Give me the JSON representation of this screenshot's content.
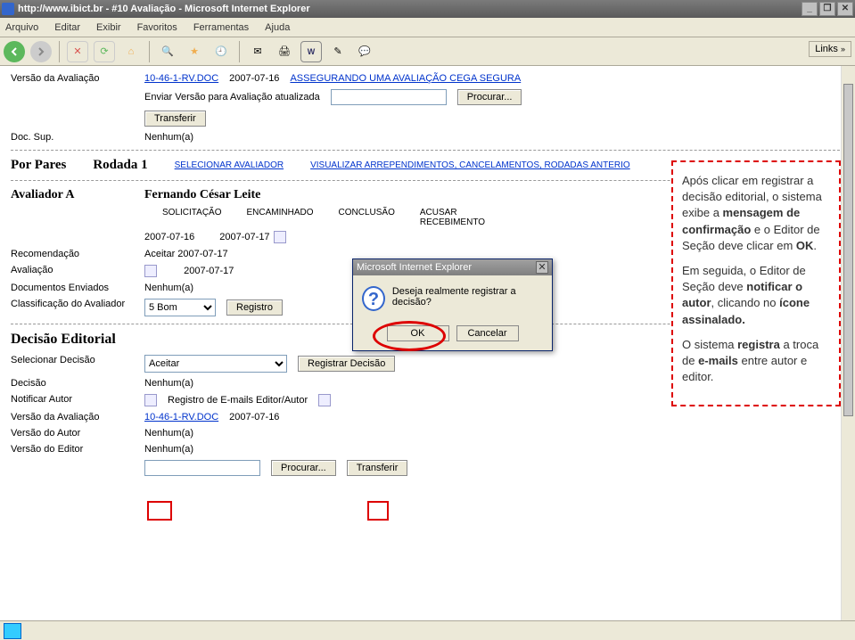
{
  "titlebar": {
    "url": "http://www.ibict.br - #10 Avaliação - Microsoft Internet Explorer"
  },
  "menubar": [
    "Arquivo",
    "Editar",
    "Exibir",
    "Favoritos",
    "Ferramentas",
    "Ajuda"
  ],
  "links_label": "Links",
  "main": {
    "versao_label": "Versão da Avaliação",
    "file_link": "10-46-1-RV.DOC",
    "file_date": "2007-07-16",
    "secure_link": "ASSEGURANDO UMA AVALIAÇÃO CEGA SEGURA",
    "enviar_label": "Enviar Versão para Avaliação atualizada",
    "procurar_btn": "Procurar...",
    "transferir_btn": "Transferir",
    "doc_sup_label": "Doc. Sup.",
    "doc_sup_value": "Nenhum(a)",
    "por_pares": "Por Pares",
    "rodada": "Rodada 1",
    "sel_avaliador": "SELECIONAR AVALIADOR",
    "visualizar": "VISUALIZAR ARREPENDIMENTOS, CANCELAMENTOS, RODADAS ANTERIO",
    "avaliador_a": "Avaliador A",
    "avaliador_nome": "Fernando César Leite",
    "headers": {
      "solicitacao": "SOLICITAÇÃO",
      "encaminhado": "ENCAMINHADO",
      "conclusao": "CONCLUSÃO",
      "acusar": "ACUSAR RECEBIMENTO"
    },
    "date1": "2007-07-16",
    "date2": "2007-07-17",
    "recomendacao_label": "Recomendação",
    "recomendacao_value": "Aceitar  2007-07-17",
    "avaliacao_label": "Avaliação",
    "avaliacao_date": "2007-07-17",
    "docs_enviados_label": "Documentos Enviados",
    "docs_enviados_value": "Nenhum(a)",
    "classificacao_label": "Classificação do Avaliador",
    "classificacao_value": "5 Bom",
    "registro_btn": "Registro",
    "decisao_title": "Decisão Editorial",
    "sel_decisao_label": "Selecionar Decisão",
    "sel_decisao_value": "Aceitar",
    "registrar_btn": "Registrar Decisão",
    "decisao_label": "Decisão",
    "decisao_value": "Nenhum(a)",
    "notificar_label": "Notificar Autor",
    "registro_emails": "Registro de E-mails Editor/Autor",
    "versao_autor_label": "Versão do Autor",
    "versao_autor_value": "Nenhum(a)",
    "versao_editor_label": "Versão do Editor",
    "versao_editor_value": "Nenhum(a)"
  },
  "dialog": {
    "title": "Microsoft Internet Explorer",
    "message": "Deseja realmente registrar a decisão?",
    "ok": "OK",
    "cancel": "Cancelar"
  },
  "annotation": {
    "p1_a": "Após clicar em registrar a decisão editorial, o sistema exibe a ",
    "p1_b": "mensagem de confirmação",
    "p1_c": " e o Editor de Seção deve clicar em ",
    "p1_d": "OK",
    "p2_a": "Em seguida, o Editor de Seção deve ",
    "p2_b": "notificar o autor",
    "p2_c": ", clicando no ",
    "p2_d": "ícone assinalado.",
    "p3_a": "O sistema ",
    "p3_b": "registra",
    "p3_c": " a troca de ",
    "p3_d": "e-mails",
    "p3_e": " entre autor e editor."
  }
}
